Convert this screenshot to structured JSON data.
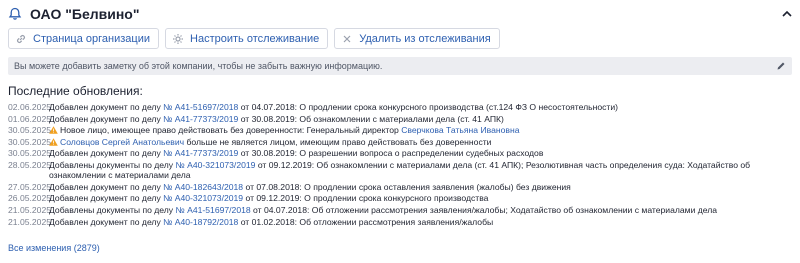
{
  "header": {
    "title": "ОАО \"Белвино\""
  },
  "actions": {
    "org_page": "Страница организации",
    "setup_tracking": "Настроить отслеживание",
    "remove_tracking": "Удалить из отслеживания"
  },
  "note": {
    "text": "Вы можете добавить заметку об этой компании, чтобы не забыть важную информацию."
  },
  "updates": {
    "title": "Последние обновления:",
    "items": [
      {
        "date": "02.06.2025",
        "pre": "Добавлен документ по делу ",
        "link": "№ А41-51697/2018",
        "post": " от 04.07.2018: О продлении срока конкурсного производства (ст.124 ФЗ О несостоятельности)"
      },
      {
        "date": "01.06.2025",
        "pre": "Добавлен документ по делу ",
        "link": "№ А41-77373/2019",
        "post": " от 30.08.2019: Об ознакомлении с материалами дела (ст. 41 АПК)"
      },
      {
        "date": "30.05.2025",
        "pre": "Новое лицо, имеющее право действовать без доверенности: Генеральный директор ",
        "link": "Сверчкова Татьяна Ивановна",
        "post": ""
      },
      {
        "date": "30.05.2025",
        "pre": "",
        "link": "Соловцов Сергей Анатольевич",
        "post": " больше не является лицом, имеющим право действовать без доверенности"
      },
      {
        "date": "30.05.2025",
        "pre": "Добавлен документ по делу ",
        "link": "№ А41-77373/2019",
        "post": " от 30.08.2019: О разрешении вопроса о распределении судебных расходов"
      },
      {
        "date": "28.05.2025",
        "pre": "Добавлены документы по делу ",
        "link": "№ А40-321073/2019",
        "post": " от 09.12.2019: Об ознакомлении с материалами дела (ст. 41 АПК); Резолютивная часть определения суда: Ходатайство об ознакомлении с материалами дела"
      },
      {
        "date": "27.05.2025",
        "pre": "Добавлен документ по делу ",
        "link": "№ А40-182643/2018",
        "post": " от 07.08.2018: О продлении срока оставления заявления (жалобы) без движения"
      },
      {
        "date": "26.05.2025",
        "pre": "Добавлен документ по делу ",
        "link": "№ А40-321073/2019",
        "post": " от 09.12.2019: О продлении срока конкурсного производства"
      },
      {
        "date": "21.05.2025",
        "pre": "Добавлены документы по делу ",
        "link": "№ А41-51697/2018",
        "post": " от 04.07.2018: Об отложении рассмотрения заявления/жалобы; Ходатайство об ознакомлении с материалами дела"
      },
      {
        "date": "21.05.2025",
        "pre": "Добавлен документ по делу ",
        "link": "№ А40-18792/2018",
        "post": " от 01.02.2018: Об отложении рассмотрения заявления/жалобы"
      }
    ],
    "all_link": "Все изменения (2879)"
  },
  "icons": {
    "header": "bell-icon",
    "collapse": "chevron-up-icon",
    "org_page": "link-icon",
    "setup_tracking": "gear-icon",
    "remove_tracking": "close-icon",
    "note": "pencil-icon",
    "new_person": "warning-icon",
    "removed_person": "warning-icon"
  },
  "colors": {
    "accent": "#2d5fb0",
    "warning": "#f0a020",
    "note_background": "#ecedf1"
  }
}
